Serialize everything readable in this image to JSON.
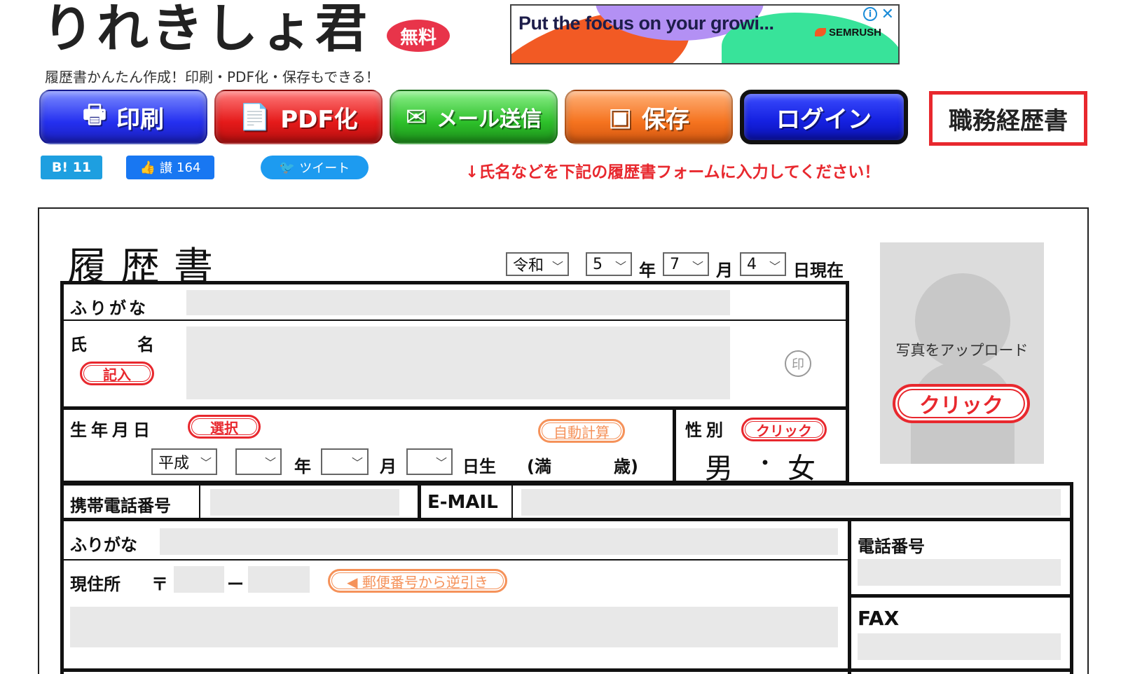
{
  "header": {
    "logo": "りれきしょ君",
    "free_badge": "無料",
    "tagline": "履歴書かんたん作成！印刷・PDF化・保存もできる！"
  },
  "ad": {
    "headline": "Put the focus on your growi...",
    "brand": "SEMRUSH",
    "info_icon": "i",
    "close_icon": "✕"
  },
  "toolbar": {
    "print": "印刷",
    "pdf": "PDF化",
    "mail": "メール送信",
    "save": "保存",
    "login": "ログイン",
    "career": "職務経歴書"
  },
  "social": {
    "hatena": "B! 11",
    "like_label": "讃",
    "like_count": "164",
    "tweet": "ツイート"
  },
  "notice": "↓氏名などを下記の履歴書フォームに入力してください！",
  "form": {
    "title": "履歴書",
    "date": {
      "era": "令和",
      "year": "5",
      "year_unit": "年",
      "month": "7",
      "month_unit": "月",
      "day": "4",
      "day_suffix": "日現在"
    },
    "furigana_label": "ふりがな",
    "name_label_1": "氏",
    "name_label_2": "名",
    "name_entry": "記入",
    "seal": "印",
    "birth_label": "生年月日",
    "birth_select": "選択",
    "auto_calc": "自動計算",
    "birth_era": "平成",
    "birth_year_unit": "年",
    "birth_month_unit": "月",
    "birth_day_unit": "日生",
    "age_open": "(満",
    "age_close": "歳)",
    "gender_label": "性別",
    "gender_click": "クリック",
    "gender_male": "男",
    "gender_dot": "・",
    "gender_female": "女",
    "mobile_label": "携帯電話番号",
    "email_label": "E-MAIL",
    "addr_furigana_label": "ふりがな",
    "address_label": "現住所",
    "postal_mark": "〒",
    "postal_dash": "ー",
    "postal_lookup": "◀ 郵便番号から逆引き",
    "phone_label": "電話番号",
    "fax_label": "FAX"
  },
  "photo": {
    "upload_text": "写真をアップロード",
    "click": "クリック"
  }
}
